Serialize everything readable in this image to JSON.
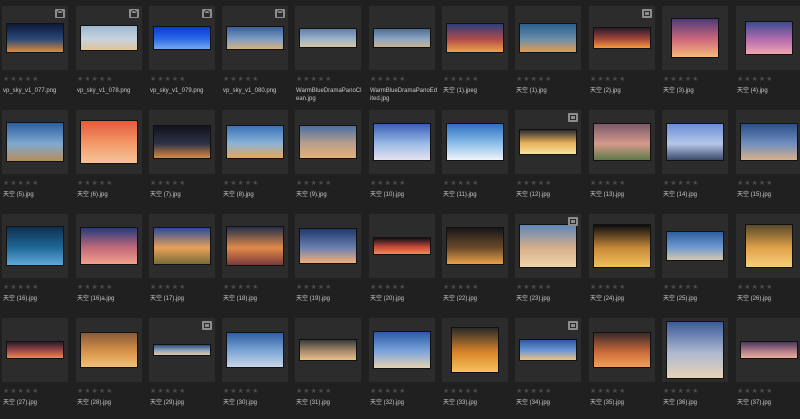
{
  "gallery": {
    "rows": [
      {
        "items": [
          {
            "name": "vp_sky_v1_077.png",
            "badge": "lock",
            "colors": [
              "#0d1a3a",
              "#2a4a7a",
              "#e08a3a"
            ]
          },
          {
            "name": "vp_sky_v1_078.png",
            "badge": "lock",
            "colors": [
              "#9fb7cf",
              "#c7d3de",
              "#e4c49c"
            ]
          },
          {
            "name": "vp_sky_v1_079.png",
            "badge": "lock",
            "colors": [
              "#0a3bd0",
              "#2b6ae8",
              "#78a8f0"
            ]
          },
          {
            "name": "vp_sky_v1_080.png",
            "badge": "lock",
            "colors": [
              "#3a5f98",
              "#7c9cc4",
              "#d9b27d"
            ]
          },
          {
            "name": "WarmBlueDramaPanoClean.jpg",
            "badge": "",
            "colors": [
              "#5d7fa7",
              "#9bb2cc",
              "#d6c3a3"
            ]
          },
          {
            "name": "WarmBlueDramaPanoEdited.jpg",
            "badge": "",
            "colors": [
              "#4d6d94",
              "#8ca6c2",
              "#c8b190"
            ]
          },
          {
            "name": "天空 (1).jpeg",
            "badge": "",
            "colors": [
              "#2e3d78",
              "#b04c4a",
              "#f0a24a"
            ]
          },
          {
            "name": "天空 (1).jpg",
            "badge": "",
            "colors": [
              "#2b5e8c",
              "#6a8fab",
              "#e59a4a"
            ]
          },
          {
            "name": "天空 (2).jpg",
            "badge": "link",
            "colors": [
              "#281b2c",
              "#a5473b",
              "#f29a3c"
            ]
          },
          {
            "name": "天空 (3).jpg",
            "badge": "",
            "colors": [
              "#4d3a7a",
              "#d06a7c",
              "#f6b97a"
            ]
          },
          {
            "name": "天空 (4).jpg",
            "badge": "",
            "colors": [
              "#3b4b8f",
              "#b46dae",
              "#f0a6b0"
            ]
          }
        ]
      },
      {
        "items": [
          {
            "name": "天空 (5).jpg",
            "badge": "",
            "colors": [
              "#2d5fa0",
              "#7fa9cf",
              "#b98d5c"
            ]
          },
          {
            "name": "天空 (6).jpg",
            "badge": "",
            "colors": [
              "#e45a3a",
              "#f39b6a",
              "#f6c49a"
            ]
          },
          {
            "name": "天空 (7).jpg",
            "badge": "",
            "colors": [
              "#11141f",
              "#2c3246",
              "#d68a48"
            ]
          },
          {
            "name": "天空 (8).jpg",
            "badge": "",
            "colors": [
              "#3a73b8",
              "#8bb3d6",
              "#e7a75a"
            ]
          },
          {
            "name": "天空 (9).jpg",
            "badge": "",
            "colors": [
              "#4b6fa2",
              "#b7a08c",
              "#e6b07a"
            ]
          },
          {
            "name": "天空 (10).jpg",
            "badge": "",
            "colors": [
              "#3a5fb8",
              "#9bbbe6",
              "#e6e2f0"
            ]
          },
          {
            "name": "天空 (11).jpg",
            "badge": "",
            "colors": [
              "#2f6fc2",
              "#8ec0ea",
              "#f0f3f8"
            ]
          },
          {
            "name": "天空 (12).jpg",
            "badge": "link",
            "colors": [
              "#2a2a30",
              "#e9b25a",
              "#f7e2a2"
            ]
          },
          {
            "name": "天空 (13).jpg",
            "badge": "",
            "colors": [
              "#7a5a6a",
              "#d49a8a",
              "#5f7a4a"
            ]
          },
          {
            "name": "天空 (14).jpg",
            "badge": "",
            "colors": [
              "#6a8fd6",
              "#b6c6e8",
              "#3a4a6a"
            ]
          },
          {
            "name": "天空 (15).jpg",
            "badge": "",
            "colors": [
              "#2b4f8a",
              "#6f8fbf",
              "#d9b08a"
            ]
          }
        ]
      },
      {
        "items": [
          {
            "name": "天空 (16).jpg",
            "badge": "",
            "colors": [
              "#0f2f4f",
              "#1f6a9a",
              "#62a8d8"
            ]
          },
          {
            "name": "天空 (16)a.jpg",
            "badge": "",
            "colors": [
              "#253a7a",
              "#c26a7a",
              "#f2a08a"
            ]
          },
          {
            "name": "天空 (17).jpg",
            "badge": "",
            "colors": [
              "#2c4a9a",
              "#e7a15a",
              "#7a6a3a"
            ]
          },
          {
            "name": "天空 (18).jpg",
            "badge": "",
            "colors": [
              "#24304a",
              "#e28a4a",
              "#7a3a3a"
            ]
          },
          {
            "name": "天空 (19).jpg",
            "badge": "",
            "colors": [
              "#203a6a",
              "#6a7fb0",
              "#f2b07a"
            ]
          },
          {
            "name": "天空 (20).jpg",
            "badge": "",
            "colors": [
              "#101018",
              "#c24a3a",
              "#f08a5a"
            ]
          },
          {
            "name": "天空 (22).jpg",
            "badge": "",
            "colors": [
              "#181818",
              "#6a4a2a",
              "#e8a04a"
            ]
          },
          {
            "name": "天空 (23).jpg",
            "badge": "link",
            "colors": [
              "#5f86b8",
              "#d6b08a",
              "#f0d4a8"
            ]
          },
          {
            "name": "天空 (24).jpg",
            "badge": "",
            "colors": [
              "#0c0c10",
              "#c88a3a",
              "#f2c05a"
            ]
          },
          {
            "name": "天空 (25).jpg",
            "badge": "",
            "colors": [
              "#2f5ea0",
              "#6e9ad0",
              "#d7c7b0"
            ]
          },
          {
            "name": "天空 (26).jpg",
            "badge": "",
            "colors": [
              "#5a4a2a",
              "#e2a24a",
              "#f6d07a"
            ]
          }
        ]
      },
      {
        "items": [
          {
            "name": "天空 (27).jpg",
            "badge": "",
            "colors": [
              "#2a1a2a",
              "#a04a4a",
              "#e88a5a"
            ]
          },
          {
            "name": "天空 (28).jpg",
            "badge": "",
            "colors": [
              "#8a5a3a",
              "#d8944a",
              "#f2c07a"
            ]
          },
          {
            "name": "天空 (29).jpg",
            "badge": "link",
            "colors": [
              "#2f4f7a",
              "#8fa6bf",
              "#e3c7a0"
            ]
          },
          {
            "name": "天空 (30).jpg",
            "badge": "",
            "colors": [
              "#2f5fa2",
              "#7fa8d8",
              "#c9d6e6"
            ]
          },
          {
            "name": "天空 (31).jpg",
            "badge": "",
            "colors": [
              "#3a3a3a",
              "#a88a6a",
              "#e6c08a"
            ]
          },
          {
            "name": "天空 (32).jpg",
            "badge": "",
            "colors": [
              "#2a5aa6",
              "#7ea6dc",
              "#e6d2b0"
            ]
          },
          {
            "name": "天空 (33).jpg",
            "badge": "",
            "colors": [
              "#2a2a2a",
              "#d8842a",
              "#f6c45a"
            ]
          },
          {
            "name": "天空 (34).jpg",
            "badge": "link",
            "colors": [
              "#2c5aa0",
              "#6f9ad6",
              "#f0c07a"
            ]
          },
          {
            "name": "天空 (35).jpg",
            "badge": "",
            "colors": [
              "#3a2a2a",
              "#c86a3a",
              "#f2a05a"
            ]
          },
          {
            "name": "天空 (36).jpg",
            "badge": "",
            "colors": [
              "#3a5a9a",
              "#aeb8d0",
              "#e6d4b8"
            ]
          },
          {
            "name": "天空 (37).jpg",
            "badge": "",
            "colors": [
              "#4a3a5a",
              "#b07a8a",
              "#e8b09a"
            ]
          }
        ]
      }
    ]
  },
  "rating": {
    "stars": "★★★★★",
    "value": 0
  }
}
